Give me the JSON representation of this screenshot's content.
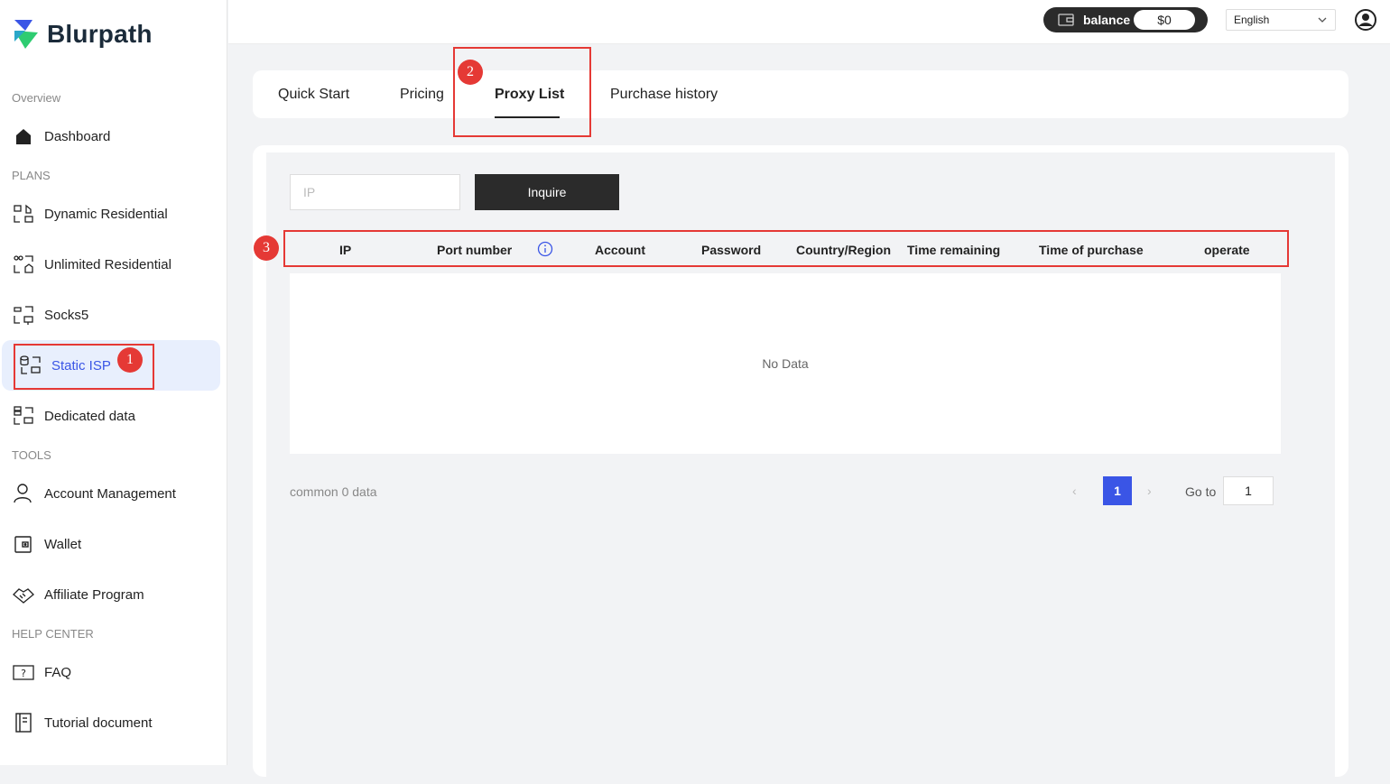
{
  "brand": {
    "name": "Blurpath"
  },
  "sidebar": {
    "sections": {
      "overview": "Overview",
      "plans": "PLANS",
      "tools": "TOOLS",
      "help": "HELP CENTER"
    },
    "items": {
      "dashboard": "Dashboard",
      "dynamic_residential": "Dynamic Residential",
      "unlimited_residential": "Unlimited Residential",
      "socks5": "Socks5",
      "static_isp": "Static ISP",
      "dedicated_data": "Dedicated data",
      "account_management": "Account Management",
      "wallet": "Wallet",
      "affiliate_program": "Affiliate Program",
      "faq": "FAQ",
      "tutorial_document": "Tutorial document"
    },
    "active": "static_isp"
  },
  "topbar": {
    "balance_label": "balance",
    "balance_value": "$0",
    "language": "English"
  },
  "tabs": {
    "quick_start": "Quick Start",
    "pricing": "Pricing",
    "proxy_list": "Proxy List",
    "purchase_history": "Purchase history",
    "active": "proxy_list"
  },
  "search": {
    "ip_placeholder": "IP",
    "inquire_label": "Inquire"
  },
  "table": {
    "headers": {
      "ip": "IP",
      "port_number": "Port number",
      "account": "Account",
      "password": "Password",
      "country_region": "Country/Region",
      "time_remaining": "Time remaining",
      "time_of_purchase": "Time of purchase",
      "operate": "operate"
    },
    "empty_text": "No Data"
  },
  "pagination": {
    "total_text": "common 0 data",
    "prev": "‹",
    "current_page": "1",
    "next": "›",
    "goto_label": "Go to",
    "goto_value": "1"
  },
  "annotations": {
    "badge1": "1",
    "badge2": "2",
    "badge3": "3",
    "color": "#e53935"
  },
  "colors": {
    "accent": "#3a55e6",
    "dark_button": "#2b2b2b",
    "active_nav_bg": "#e8effd"
  }
}
